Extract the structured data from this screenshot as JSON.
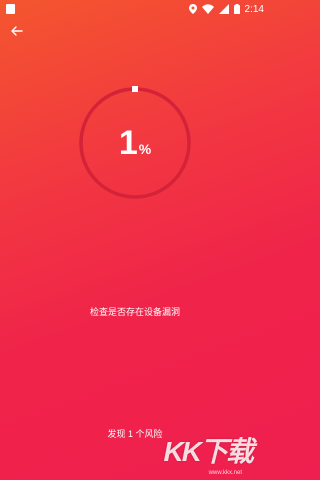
{
  "status_bar": {
    "time": "2:14"
  },
  "scan": {
    "progress_number": "1",
    "progress_unit": "%",
    "progress_fraction": 0.01,
    "status_text": "检查是否存在设备漏洞",
    "risk_text": "发现 1 个风险"
  },
  "watermark": {
    "text": "KK下载",
    "sub": "www.kkx.net"
  },
  "colors": {
    "gradient_top": "#f4562e",
    "gradient_bottom": "#ef1f4f",
    "ring_track": "#d42338"
  }
}
